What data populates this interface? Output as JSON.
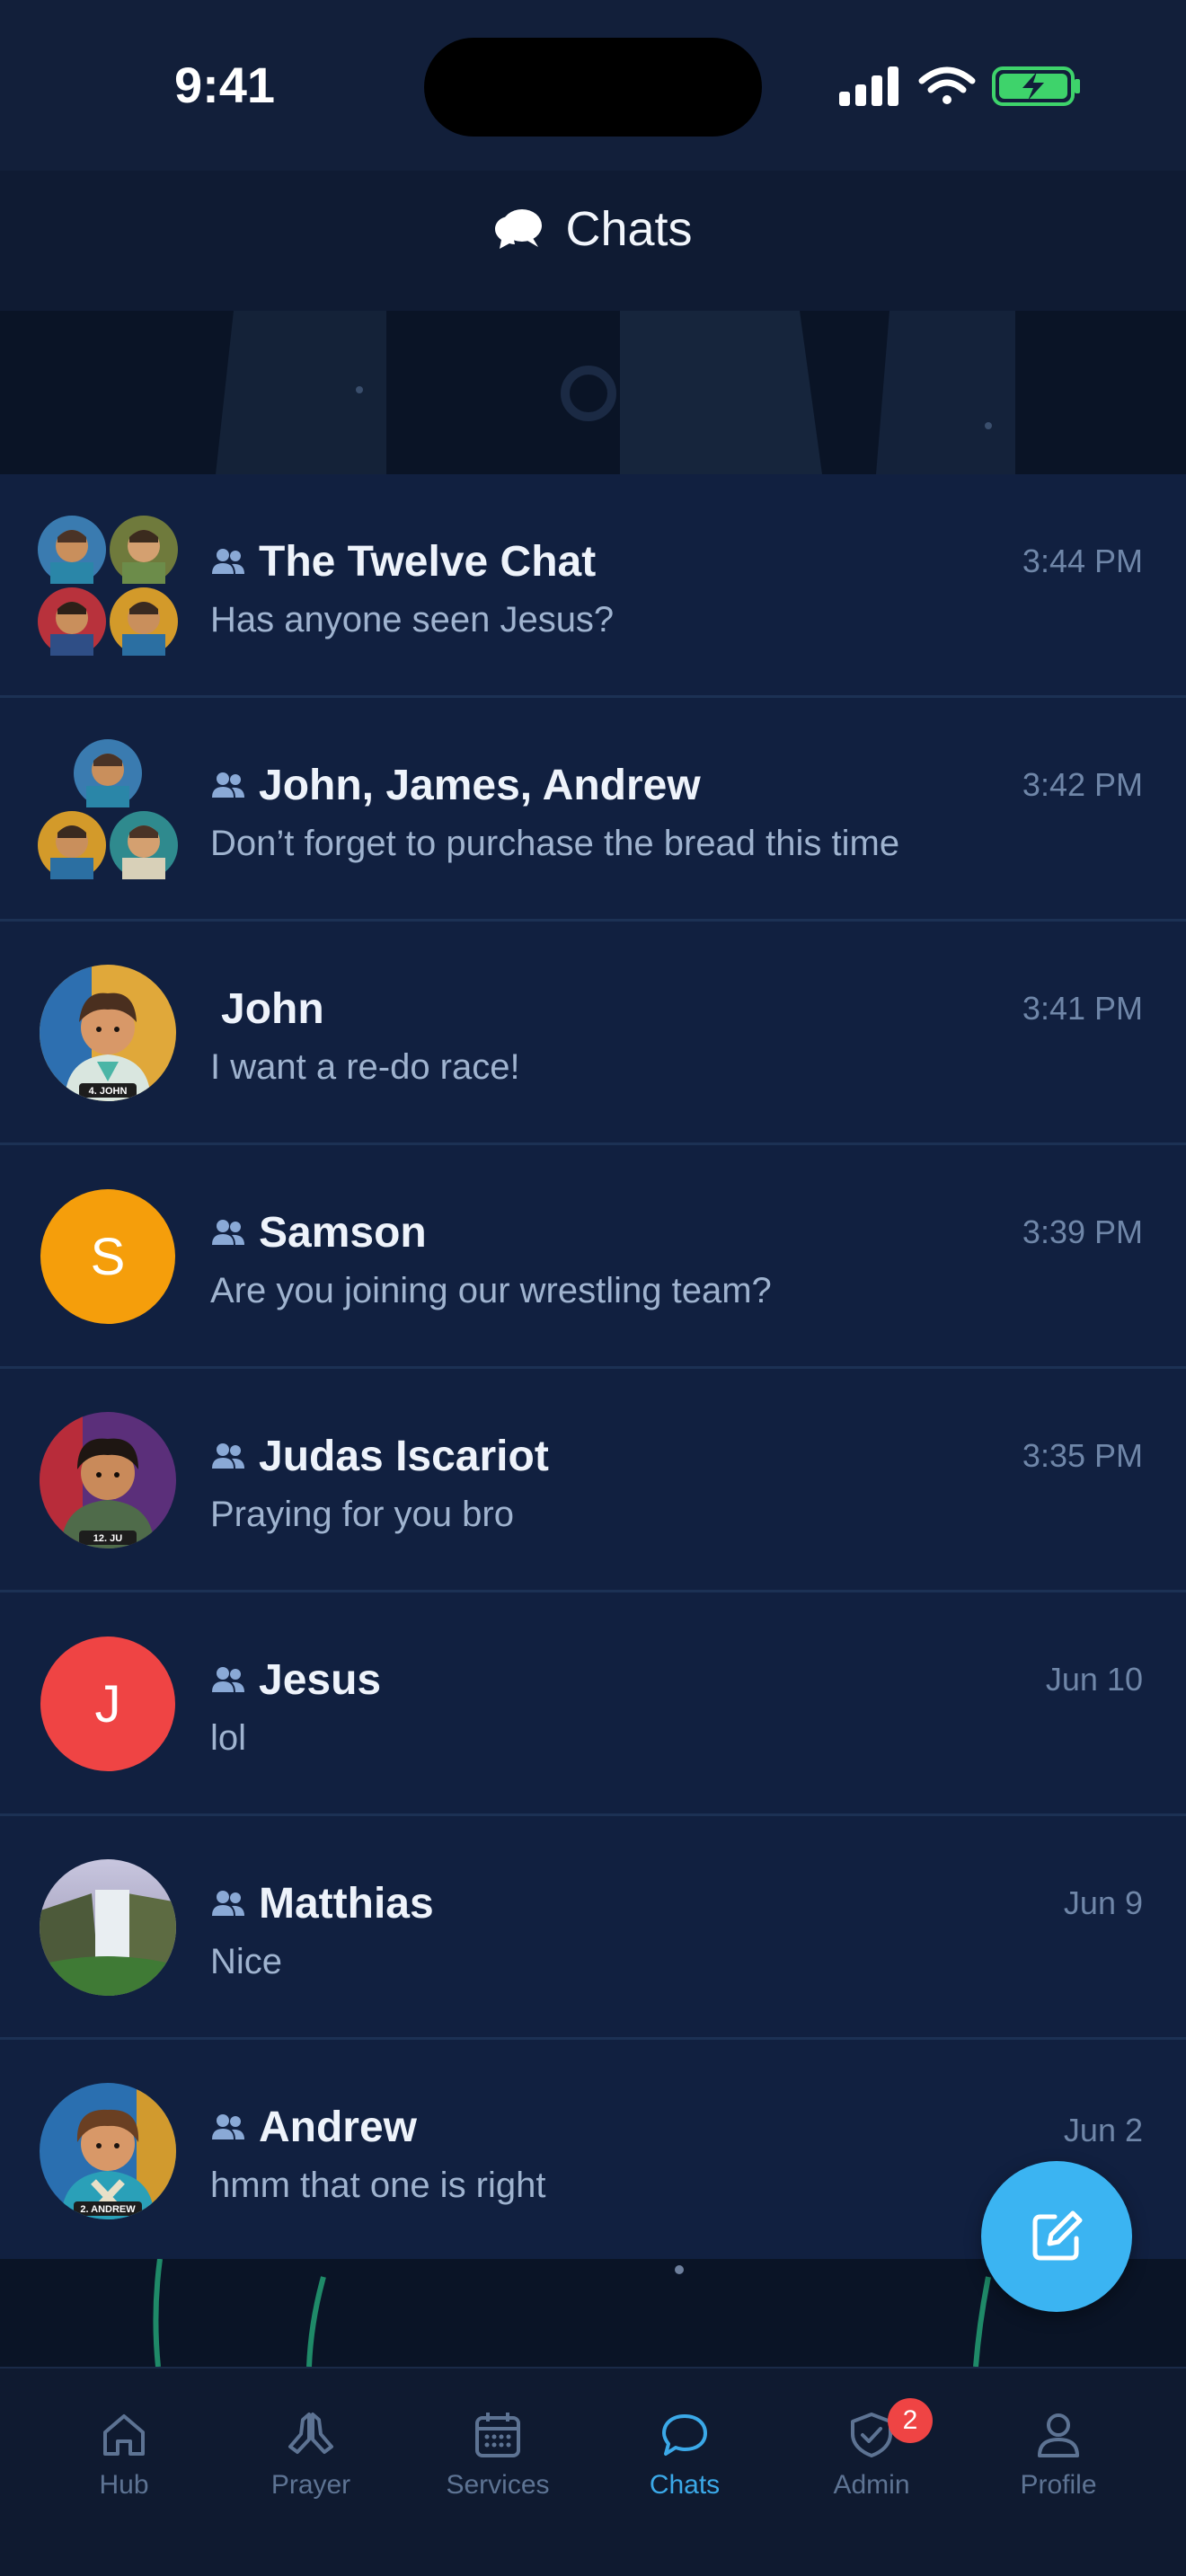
{
  "status_bar": {
    "time": "9:41"
  },
  "header": {
    "title": "Chats",
    "icon": "chat-bubbles-icon"
  },
  "chats": [
    {
      "name": "The Twelve Chat",
      "preview": "Has anyone seen Jesus?",
      "time": "3:44 PM",
      "group": true,
      "avatar": "group-collage-4"
    },
    {
      "name": "John, James, Andrew",
      "preview": "Don’t forget to purchase the bread this time",
      "time": "3:42 PM",
      "group": true,
      "avatar": "group-collage-3"
    },
    {
      "name": "John",
      "preview": "I want a re-do race!",
      "time": "3:41 PM",
      "group": false,
      "avatar": "photo-john",
      "avatar_caption": "4. JOHN"
    },
    {
      "name": "Samson",
      "preview": "Are you joining our wrestling team?",
      "time": "3:39 PM",
      "group": true,
      "avatar_letter": "S",
      "avatar_color": "#f59e0b"
    },
    {
      "name": "Judas Iscariot",
      "preview": "Praying for you bro",
      "time": "3:35 PM",
      "group": true,
      "avatar": "photo-judas",
      "avatar_caption": "12. JU"
    },
    {
      "name": "Jesus",
      "preview": "lol",
      "time": "Jun 10",
      "group": true,
      "avatar_letter": "J",
      "avatar_color": "#ef4444"
    },
    {
      "name": "Matthias",
      "preview": "Nice",
      "time": "Jun 9",
      "group": true,
      "avatar": "photo-waterfall"
    },
    {
      "name": "Andrew",
      "preview": "hmm that one is right",
      "time": "Jun 2",
      "group": true,
      "avatar": "photo-andrew",
      "avatar_caption": "2. ANDREW"
    }
  ],
  "fab": {
    "icon": "compose-icon"
  },
  "tabs": [
    {
      "label": "Hub",
      "icon": "home-icon"
    },
    {
      "label": "Prayer",
      "icon": "praying-hands-icon"
    },
    {
      "label": "Services",
      "icon": "calendar-icon"
    },
    {
      "label": "Chats",
      "icon": "chat-icon",
      "active": true
    },
    {
      "label": "Admin",
      "icon": "shield-check-icon",
      "badge": "2"
    },
    {
      "label": "Profile",
      "icon": "person-icon"
    }
  ],
  "colors": {
    "accent": "#3bb4f2",
    "background": "#0f1b33",
    "row": "#112040"
  }
}
